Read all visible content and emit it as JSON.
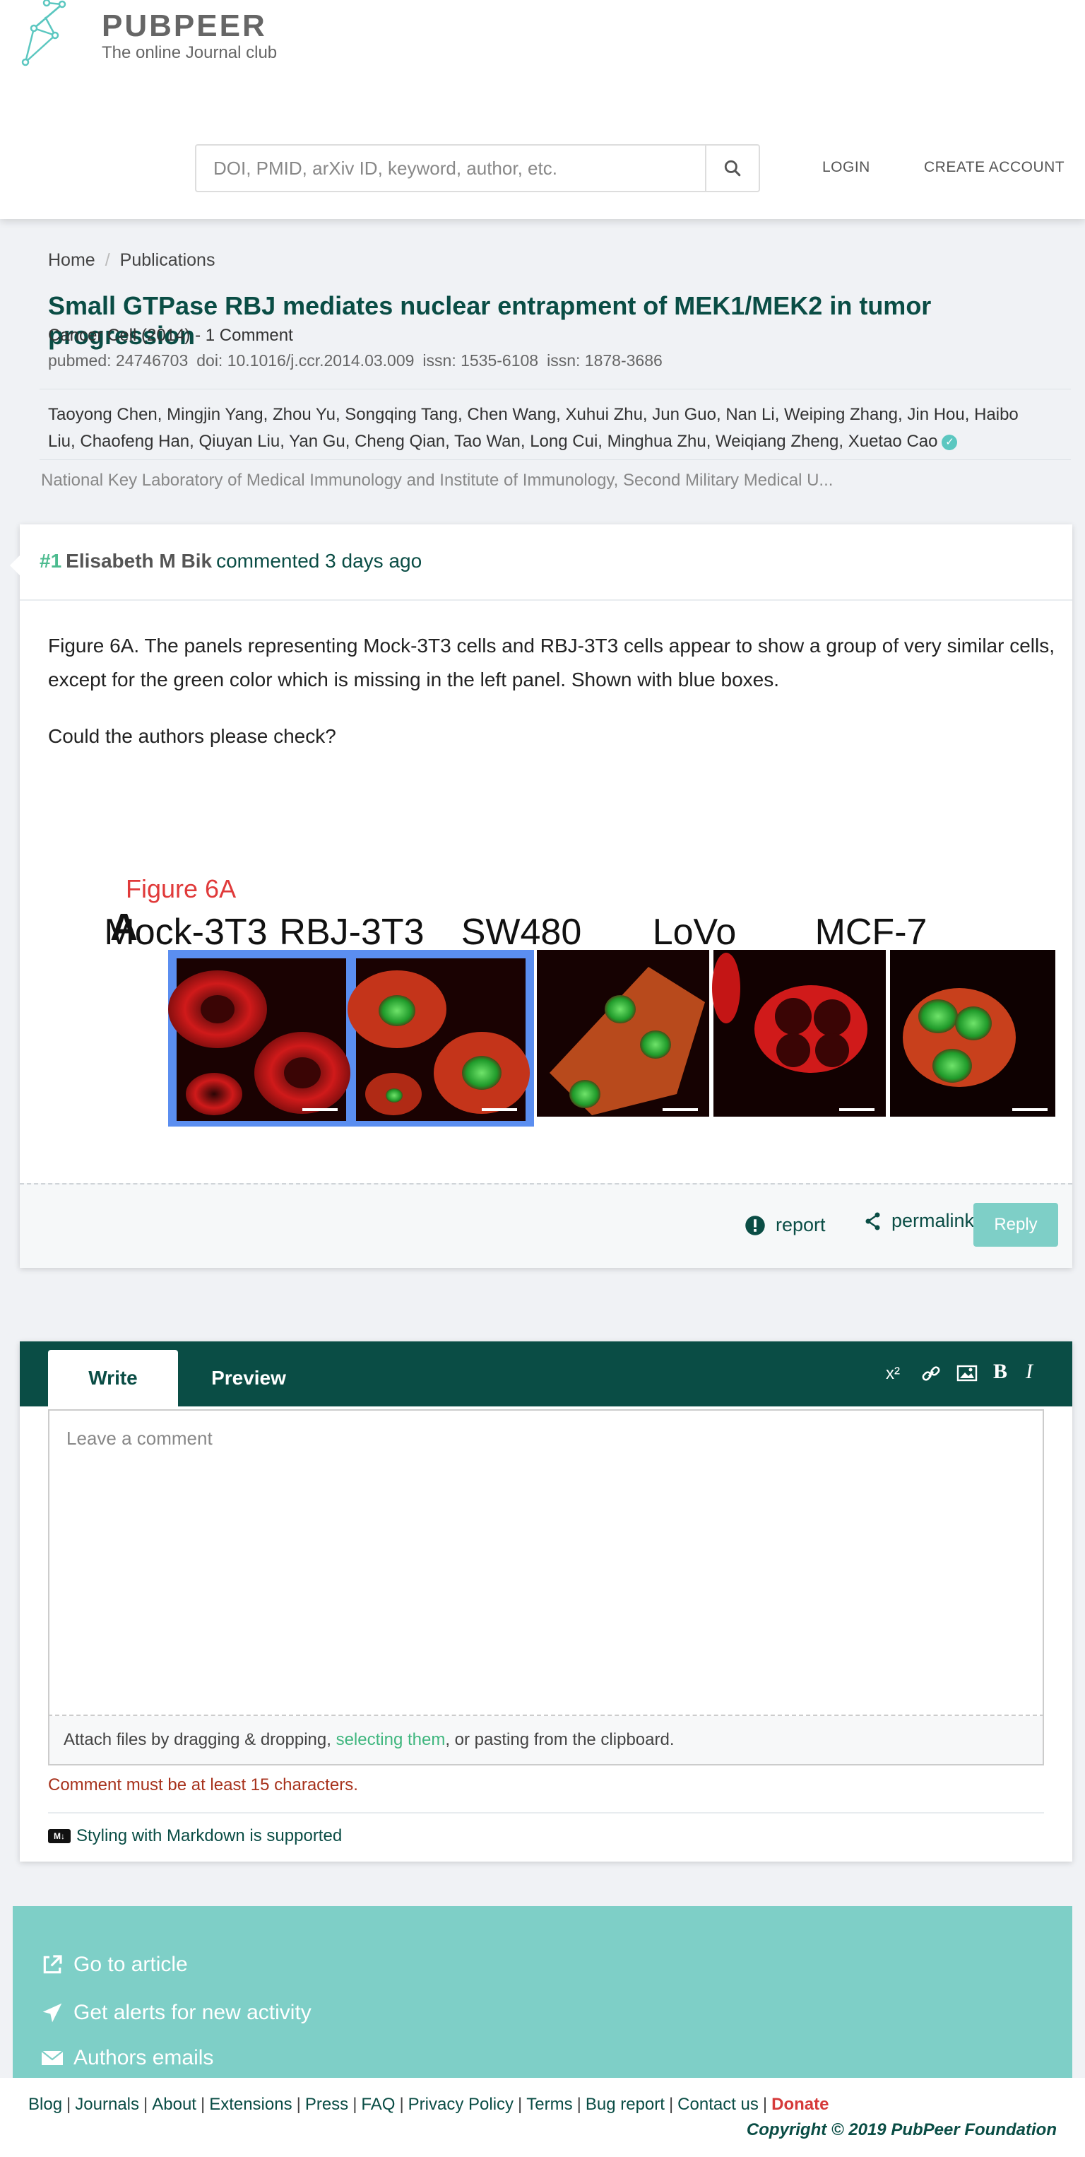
{
  "header": {
    "brand_name": "PUBPEER",
    "tagline": "The online Journal club",
    "search_placeholder": "DOI, PMID, arXiv ID, keyword, author, etc.",
    "login": "LOGIN",
    "create_account": "CREATE ACCOUNT"
  },
  "breadcrumb": {
    "home": "Home",
    "sep": "/",
    "publications": "Publications"
  },
  "publication": {
    "title": "Small GTPase RBJ mediates nuclear entrapment of MEK1/MEK2 in tumor progression",
    "journal_line": "Cancer Cell (2014) - 1 Comment",
    "pubmed": "pubmed: 24746703",
    "doi": "doi: 10.1016/j.ccr.2014.03.009",
    "issn1": "issn: 1535-6108",
    "issn2": "issn: 1878-3686",
    "authors": "Taoyong Chen, Mingjin Yang, Zhou Yu, Songqing Tang, Chen Wang, Xuhui Zhu, Jun Guo, Nan Li, Weiping Zhang, Jin Hou, Haibo Liu, Chaofeng Han, Qiuyan Liu, Yan Gu, Cheng Qian, Tao Wan, Long Cui, Minghua Zhu, Weiqiang Zheng, Xuetao Cao",
    "institution": "National Key Laboratory of Medical Immunology and Institute of Immunology, Second Military Medical U..."
  },
  "comment": {
    "number": "#1",
    "author": "Elisabeth M Bik",
    "action": "commented 3 days ago",
    "paragraph1": "Figure 6A. The panels representing Mock-3T3 cells and RBJ-3T3 cells appear to show a group of very similar cells, except for the green color which is missing in the left panel. Shown with blue boxes.",
    "paragraph2": "Could the authors please check?",
    "figure": {
      "caption": "Figure 6A",
      "panel_letter": "A",
      "labels": [
        "Mock-3T3",
        "RBJ-3T3",
        "SW480",
        "LoVo",
        "MCF-7"
      ]
    },
    "report": "report",
    "permalink": "permalink",
    "reply": "Reply"
  },
  "editor": {
    "tab_write": "Write",
    "tab_preview": "Preview",
    "tool_superscript": "x²",
    "tool_bold": "B",
    "tool_italic": "I",
    "placeholder": "Leave a comment",
    "attach_prefix": "Attach files by dragging & dropping, ",
    "attach_link": "selecting them",
    "attach_suffix": ", or pasting from the clipboard.",
    "error": "Comment must be at least 15 characters.",
    "markdown_badge": "M↓",
    "markdown_note": "Styling with Markdown is supported"
  },
  "panel": {
    "go_to_article": "Go to article",
    "alerts": "Get alerts for new activity",
    "authors_emails": "Authors emails"
  },
  "footer": {
    "links": [
      "Blog",
      "Journals",
      "About",
      "Extensions",
      "Press",
      "FAQ",
      "Privacy Policy",
      "Terms",
      "Bug report",
      "Contact us"
    ],
    "donate": "Donate",
    "copyright": "Copyright © 2019 PubPeer Foundation"
  },
  "colors": {
    "brand_dark": "#0a4d45",
    "accent_teal": "#7ecfc7",
    "comment_number": "#4cbb8f",
    "error": "#a7321c",
    "donate": "#d63a3a",
    "figure_highlight": "#5b8ef0"
  }
}
